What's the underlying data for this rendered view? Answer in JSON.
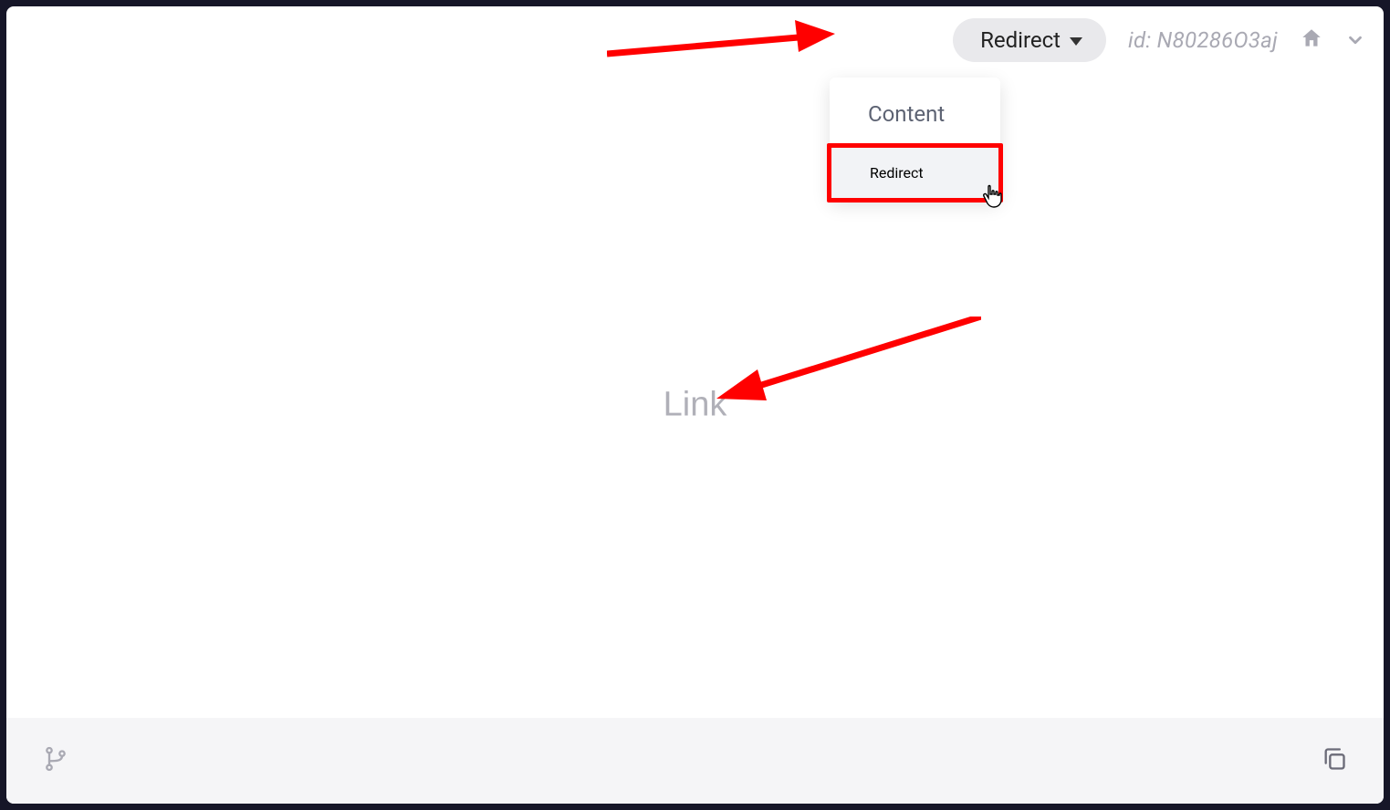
{
  "header": {
    "type_selector_label": "Redirect",
    "id_text": "id: N80286O3aj"
  },
  "dropdown": {
    "items": [
      {
        "label": "Content"
      },
      {
        "label": "Redirect"
      }
    ]
  },
  "main": {
    "link_placeholder": "Link"
  }
}
